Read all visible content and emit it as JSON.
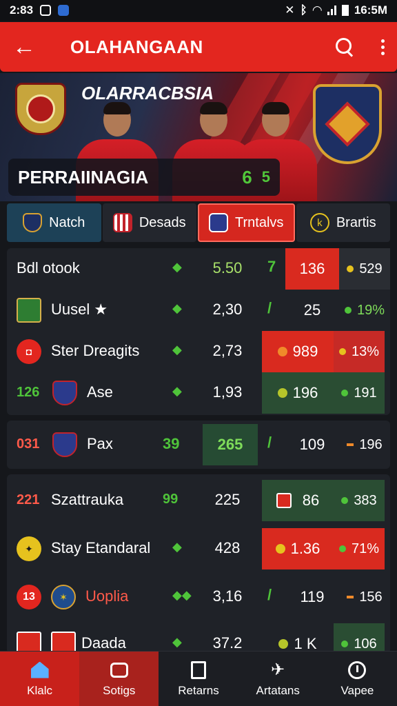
{
  "status_bar": {
    "time": "2:83",
    "right_time": "16:5M"
  },
  "app_bar": {
    "title": "OLAHANGAAN"
  },
  "hero": {
    "brand": "OLARRACBSIA",
    "banner_title": "PERRAIINAGIA",
    "banner_score": "6",
    "banner_score2": "5"
  },
  "tabs": [
    {
      "label": "Natch"
    },
    {
      "label": "Desads"
    },
    {
      "label": "Trntalvs"
    },
    {
      "label": "Brartis"
    }
  ],
  "rows": [
    {
      "lead": "",
      "name": "Bdl otook",
      "arrow": "◆",
      "value": "5.50",
      "tick": "7",
      "c1": "136",
      "c2": "529"
    },
    {
      "lead": "",
      "name": "Uusel ★",
      "arrow": "◆",
      "value": "2,30",
      "tick": "/",
      "c1": "25",
      "c2": "19%"
    },
    {
      "lead": "",
      "name": "Ster Dreagits",
      "arrow": "◆",
      "value": "2,73",
      "tick": "",
      "c1": "989",
      "c2": "13%"
    },
    {
      "lead": "126",
      "name": "Ase",
      "arrow": "◆",
      "value": "1,93",
      "tick": "",
      "c1": "196",
      "c2": "191"
    },
    {
      "lead": "031",
      "name": "Pax",
      "arrow": "39",
      "value": "265",
      "tick": "/",
      "c1": "109",
      "c2": "196"
    },
    {
      "lead": "221",
      "name": "Szattrauka",
      "arrow": "99",
      "value": "225",
      "tick": "",
      "c1": "86",
      "c2": "383"
    },
    {
      "lead": "",
      "name": "Stay Etandaral",
      "arrow": "◆",
      "value": "428",
      "tick": "",
      "c1": "1.36",
      "c2": "71%"
    },
    {
      "lead": "13",
      "name": "Uoplia",
      "arrow": "◆◆",
      "value": "3,16",
      "tick": "/",
      "c1": "119",
      "c2": "156"
    },
    {
      "lead": "",
      "name": "Daada",
      "arrow": "◆",
      "value": "37.2",
      "tick": "",
      "c1": "1 K",
      "c2": "106"
    }
  ],
  "bottom_nav": [
    {
      "label": "Klalc"
    },
    {
      "label": "Sotigs"
    },
    {
      "label": "Retarns"
    },
    {
      "label": "Artatans"
    },
    {
      "label": "Vapee"
    }
  ],
  "colors": {
    "accent_red": "#e3261f",
    "positive_green": "#4fc43a",
    "background": "#15171b"
  }
}
